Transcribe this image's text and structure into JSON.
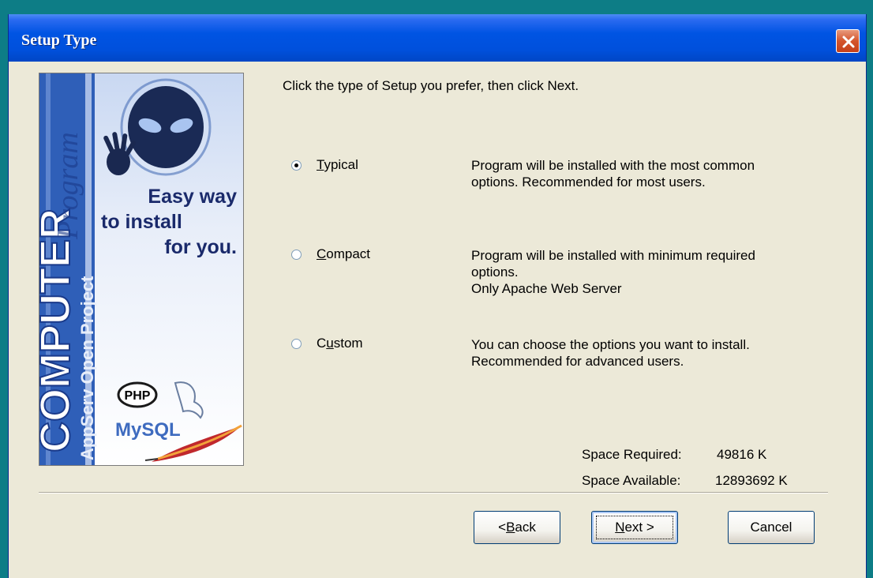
{
  "window": {
    "title": "Setup Type"
  },
  "banner": {
    "logo_text": "COMPUTER",
    "vertical_text": "AppServ Open Project",
    "script_text": "Program",
    "tagline_line1": "Easy way",
    "tagline_line2": "to install",
    "tagline_line3": "for you.",
    "php_text": "PHP",
    "mysql_text": "MySQL"
  },
  "content": {
    "instruction": "Click the type of Setup you prefer, then click Next.",
    "options": [
      {
        "label_pre": "",
        "label_key": "T",
        "label_post": "ypical",
        "selected": true,
        "description": [
          "Program will be installed with the most common",
          "options. Recommended for most users."
        ]
      },
      {
        "label_pre": "",
        "label_key": "C",
        "label_post": "ompact",
        "selected": false,
        "description": [
          "Program will be installed with minimum required",
          "options.",
          "Only Apache Web Server"
        ]
      },
      {
        "label_pre": "C",
        "label_key": "u",
        "label_post": "stom",
        "selected": false,
        "description": [
          "You can choose the options you want to install.",
          "Recommended for advanced users."
        ]
      }
    ],
    "space_required_label": "Space Required:",
    "space_required_value": "49816 K",
    "space_available_label": "Space Available:",
    "space_available_value": "12893692 K"
  },
  "buttons": {
    "back": {
      "pre": "< ",
      "key": "B",
      "post": "ack"
    },
    "next": {
      "pre": "",
      "key": "N",
      "post": "ext >"
    },
    "cancel": "Cancel"
  },
  "colors": {
    "titlebar": "#0054e3",
    "dialog_bg": "#ece9d8",
    "desktop": "#0d7d86",
    "close_button": "#d4552c"
  },
  "icons": [
    "close-icon",
    "alien-icon",
    "hand-icon",
    "dolphin-icon",
    "feather-icon"
  ]
}
